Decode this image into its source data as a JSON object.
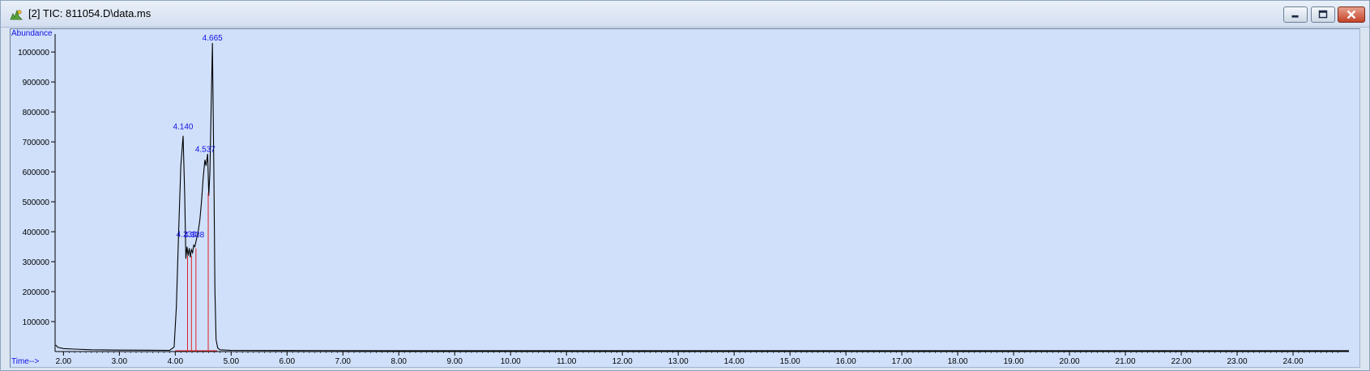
{
  "window": {
    "title": "[2] TIC: 811054.D\\data.ms",
    "app_icon": "chromatogram-icon",
    "buttons": {
      "minimize": "minimize-icon",
      "maximize": "maximize-icon",
      "close": "close-icon"
    }
  },
  "chart_data": {
    "type": "line",
    "ylabel": "Abundance",
    "xlabel": "Time-->",
    "xlim": [
      1.85,
      25.0
    ],
    "ylim": [
      0,
      1060000
    ],
    "x_ticks": [
      "2.00",
      "3.00",
      "4.00",
      "5.00",
      "6.00",
      "7.00",
      "8.00",
      "9.00",
      "10.00",
      "11.00",
      "12.00",
      "13.00",
      "14.00",
      "15.00",
      "16.00",
      "17.00",
      "18.00",
      "19.00",
      "20.00",
      "21.00",
      "22.00",
      "23.00",
      "24.00"
    ],
    "x_tick_values": [
      2,
      3,
      4,
      5,
      6,
      7,
      8,
      9,
      10,
      11,
      12,
      13,
      14,
      15,
      16,
      17,
      18,
      19,
      20,
      21,
      22,
      23,
      24
    ],
    "y_ticks": [
      "100000",
      "200000",
      "300000",
      "400000",
      "500000",
      "600000",
      "700000",
      "800000",
      "900000",
      "1000000"
    ],
    "y_tick_values": [
      100000,
      200000,
      300000,
      400000,
      500000,
      600000,
      700000,
      800000,
      900000,
      1000000
    ],
    "series": [
      {
        "color": "#000000",
        "x": [
          1.86,
          1.9,
          2.0,
          2.2,
          2.5,
          3.0,
          3.5,
          3.9,
          3.98,
          4.02,
          4.06,
          4.1,
          4.14,
          4.17,
          4.19,
          4.21,
          4.23,
          4.25,
          4.27,
          4.29,
          4.31,
          4.33,
          4.35,
          4.38,
          4.41,
          4.44,
          4.47,
          4.5,
          4.53,
          4.55,
          4.58,
          4.6,
          4.62,
          4.64,
          4.665,
          4.69,
          4.71,
          4.73,
          4.76,
          4.8,
          5.0,
          6.0,
          8.0,
          10.0,
          12.0,
          14.0,
          16.0,
          18.0,
          20.0,
          22.0,
          24.0,
          25.0
        ],
        "y": [
          22000,
          14000,
          10000,
          8000,
          6000,
          5000,
          4500,
          4000,
          15000,
          150000,
          400000,
          620000,
          720000,
          520000,
          310000,
          350000,
          320000,
          345000,
          315000,
          340000,
          330000,
          355000,
          350000,
          375000,
          400000,
          440000,
          500000,
          580000,
          640000,
          620000,
          660000,
          520000,
          600000,
          800000,
          1030000,
          620000,
          200000,
          40000,
          12000,
          6000,
          4000,
          3500,
          3000,
          3000,
          3000,
          3000,
          3000,
          3000,
          3000,
          3000,
          3000,
          3000
        ]
      }
    ],
    "peak_labels": [
      {
        "x": 4.14,
        "y": 720000,
        "label": "4.140"
      },
      {
        "x": 4.23,
        "y": 350000,
        "label": "4.230"
      },
      {
        "x": 4.338,
        "y": 360000,
        "label": "4.338"
      },
      {
        "x": 4.537,
        "y": 640000,
        "label": "4.537"
      },
      {
        "x": 4.665,
        "y": 1030000,
        "label": "4.665"
      }
    ],
    "integration_marks": [
      {
        "x": 4.22,
        "y": 320000
      },
      {
        "x": 4.29,
        "y": 320000
      },
      {
        "x": 4.37,
        "y": 345000
      },
      {
        "x": 4.59,
        "y": 530000
      }
    ],
    "baseline_segments": [
      {
        "x1": 4.0,
        "x2": 4.75
      }
    ],
    "colors": {
      "plot_bg": "#d0e0fb",
      "trace": "#000000",
      "peak_label": "#1010e0",
      "integration": "#e02020",
      "axis_text": "#000000",
      "ylabel": "#1010e0",
      "xlabel": "#1010e0"
    }
  }
}
